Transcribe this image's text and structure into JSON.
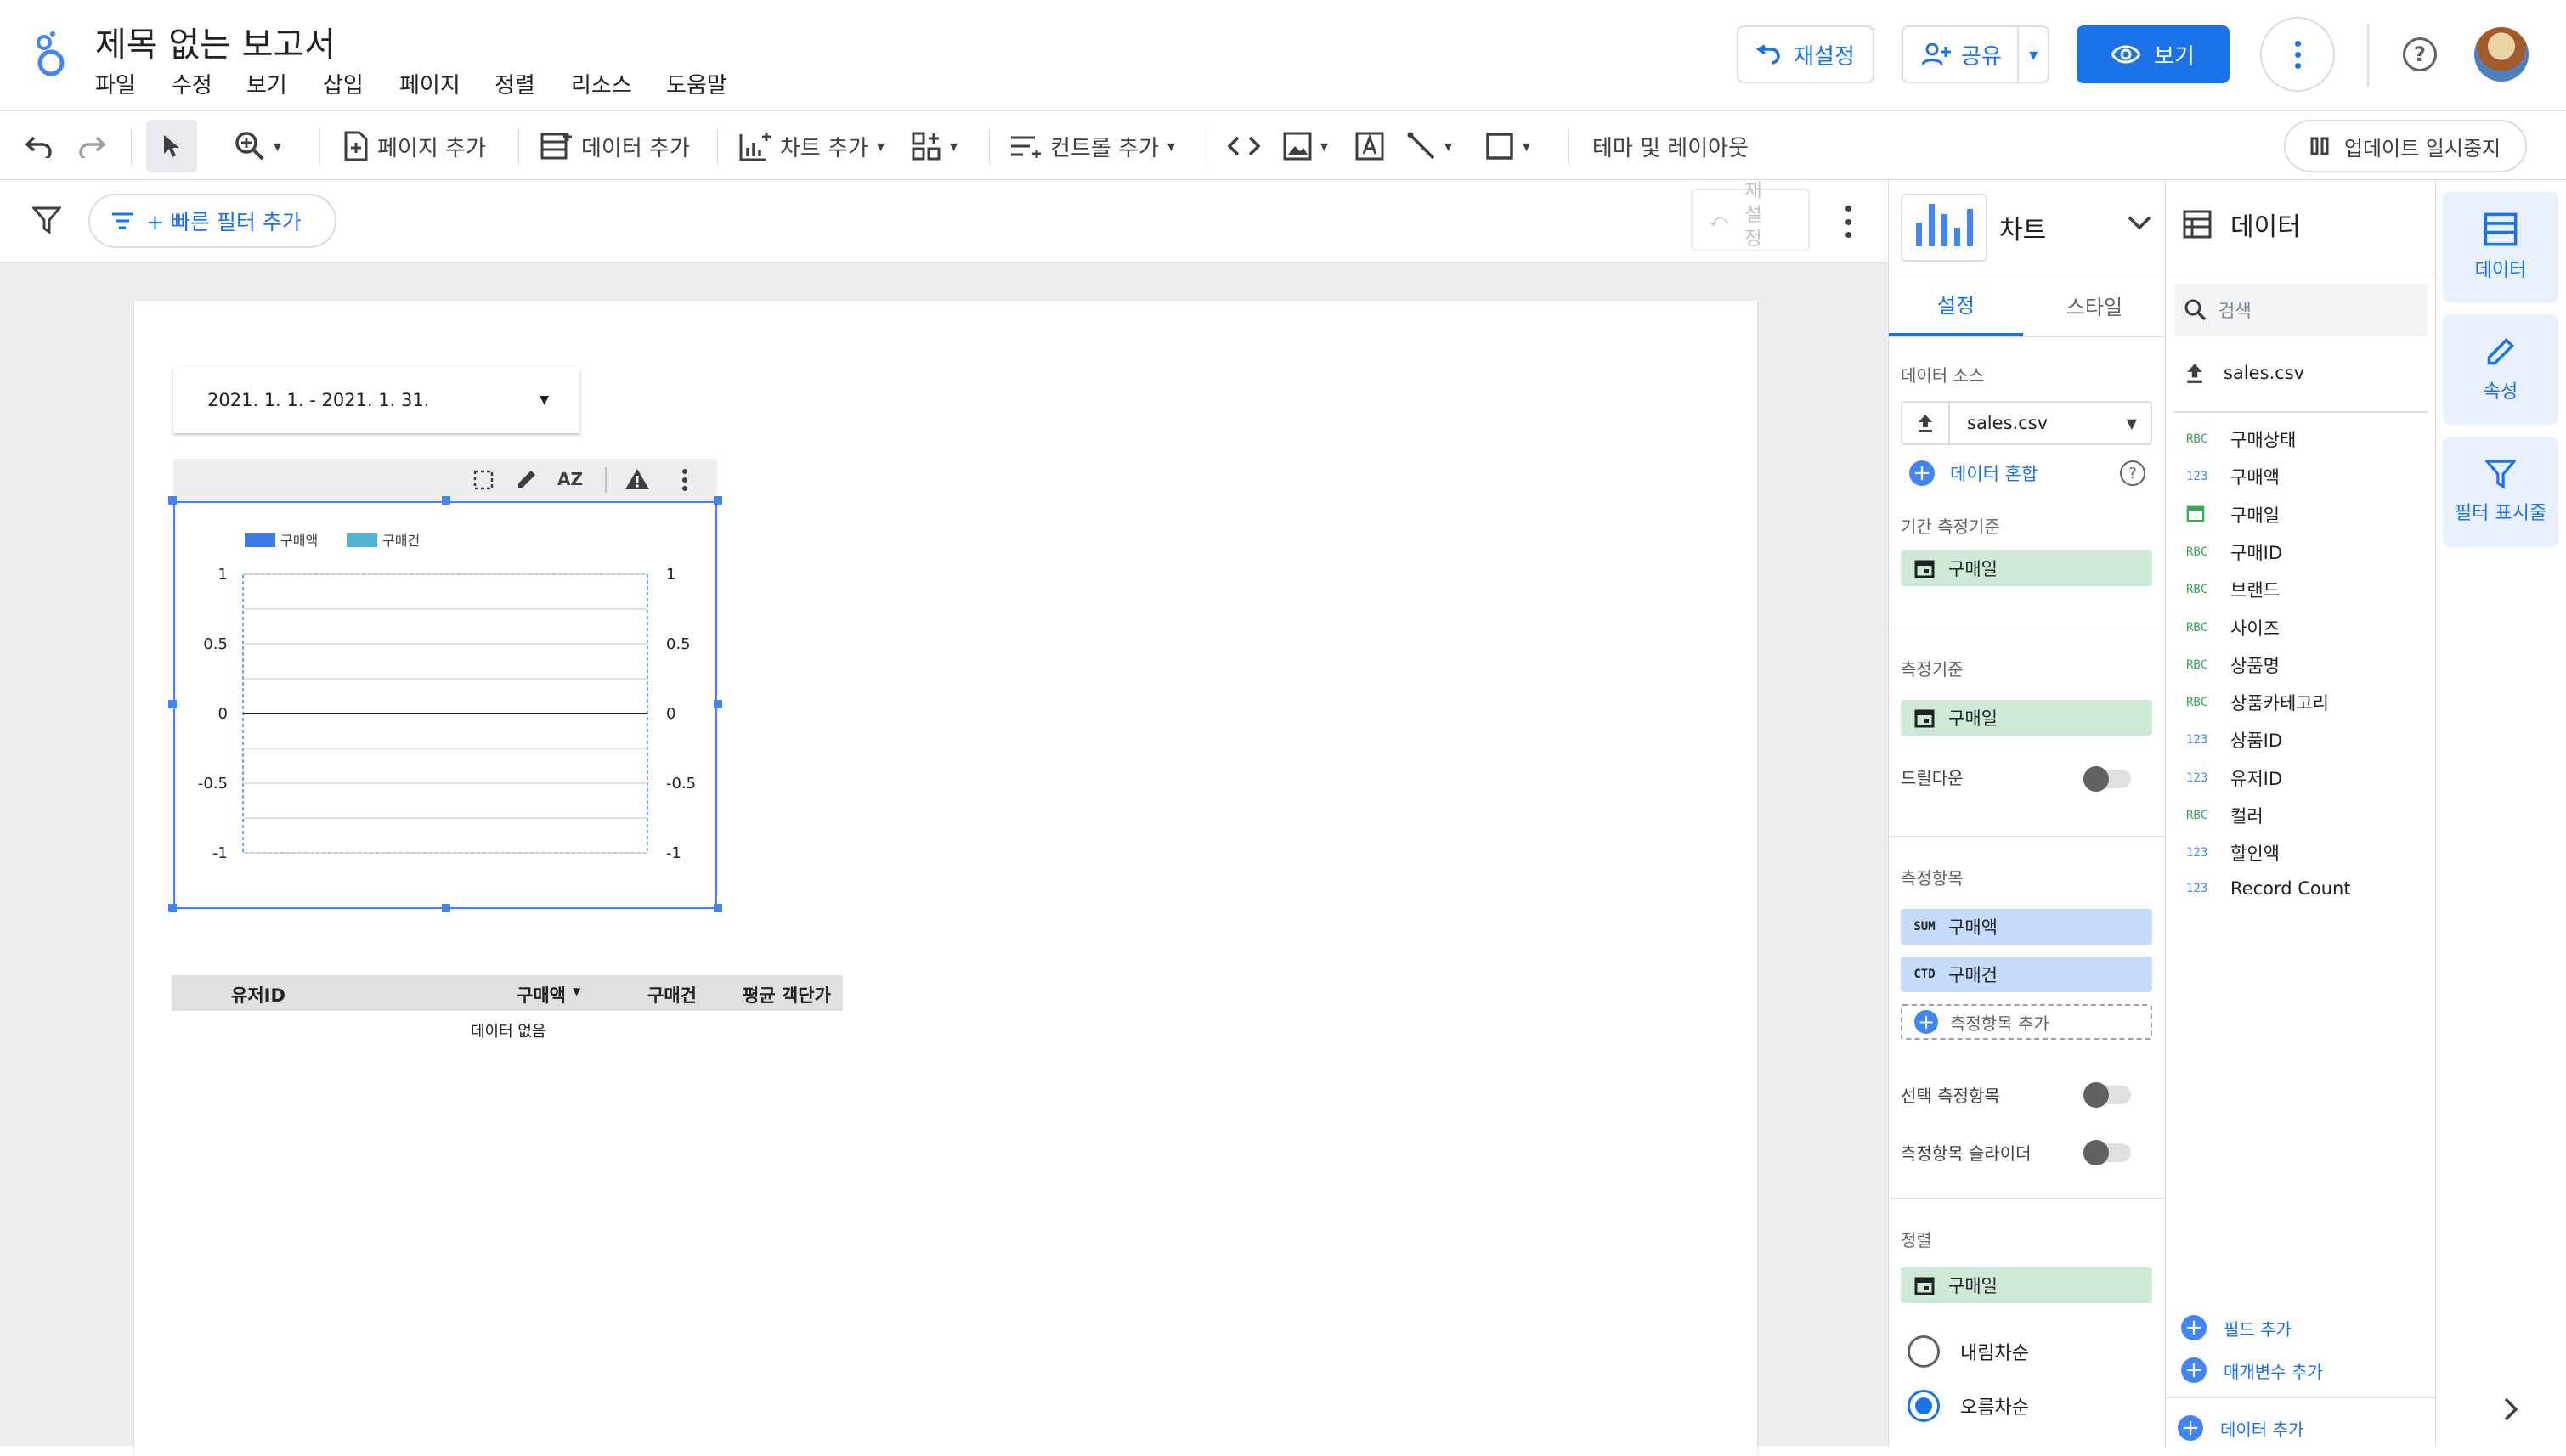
{
  "app": {
    "title": "제목 없는 보고서",
    "menus": [
      "파일",
      "수정",
      "보기",
      "삽입",
      "페이지",
      "정렬",
      "리소스",
      "도움말"
    ],
    "reset_label": "재설정",
    "share_label": "공유",
    "view_label": "보기"
  },
  "toolbar": {
    "add_page": "페이지 추가",
    "add_data": "데이터 추가",
    "add_chart": "차트 추가",
    "add_control": "컨트롤 추가",
    "theme_layout": "테마 및 레이아웃",
    "pause_updates": "업데이트 일시중지"
  },
  "filterbar": {
    "quick_filter": "+ 빠른 필터 추가",
    "reset_chars": [
      "재",
      "설",
      "정"
    ]
  },
  "report": {
    "date_range": "2021. 1. 1. - 2021. 1. 31.",
    "table": {
      "headers": [
        "유저ID",
        "구매액",
        "구매건",
        "평균 객단가"
      ],
      "empty_text": "데이터 없음"
    }
  },
  "chart_data": {
    "type": "bar",
    "legend": [
      "구매액",
      "구매건"
    ],
    "legend_colors": [
      "#3c7ae6",
      "#50b3d2"
    ],
    "y_ticks": [
      "1",
      "0.5",
      "0",
      "-0.5",
      "-1"
    ],
    "y_right_ticks": [
      "1",
      "0.5",
      "0",
      "-0.5",
      "-1"
    ],
    "ylim": [
      -1,
      1
    ],
    "categories": [],
    "series": []
  },
  "chart_panel": {
    "title": "차트",
    "tabs": [
      "설정",
      "스타일"
    ],
    "data_source_label": "데이터 소스",
    "data_source": "sales.csv",
    "blend_data": "데이터 혼합",
    "date_range_dim_label": "기간 측정기준",
    "date_range_dim": "구매일",
    "dimension_label": "측정기준",
    "dimension": "구매일",
    "drilldown_label": "드릴다운",
    "metric_label": "측정항목",
    "metrics": [
      {
        "agg": "SUM",
        "name": "구매액"
      },
      {
        "agg": "CTD",
        "name": "구매건"
      }
    ],
    "add_metric": "측정항목 추가",
    "optional_metrics": "선택 측정항목",
    "metric_slider": "측정항목 슬라이더",
    "sort_label": "정렬",
    "sort_field": "구매일",
    "sort_desc": "내림차순",
    "sort_asc": "오름차순"
  },
  "data_panel": {
    "title": "데이터",
    "search_placeholder": "검색",
    "source": "sales.csv",
    "fields": [
      {
        "type": "RBC",
        "name": "구매상태"
      },
      {
        "type": "123",
        "name": "구매액"
      },
      {
        "type": "cal",
        "name": "구매일"
      },
      {
        "type": "RBC",
        "name": "구매ID"
      },
      {
        "type": "RBC",
        "name": "브랜드"
      },
      {
        "type": "RBC",
        "name": "사이즈"
      },
      {
        "type": "RBC",
        "name": "상품명"
      },
      {
        "type": "RBC",
        "name": "상품카테고리"
      },
      {
        "type": "123",
        "name": "상품ID"
      },
      {
        "type": "123",
        "name": "유저ID"
      },
      {
        "type": "RBC",
        "name": "컬러"
      },
      {
        "type": "123",
        "name": "할인액"
      },
      {
        "type": "123",
        "name": "Record Count"
      }
    ],
    "add_field": "필드 추가",
    "add_param": "매개변수 추가",
    "add_data": "데이터 추가"
  },
  "rail": {
    "data": "데이터",
    "props": "속성",
    "filters": "필터 표시줄"
  },
  "colors": {
    "accent": "#1a73e8",
    "green_chip": "#ceead6",
    "blue_chip": "#c6dafc"
  }
}
